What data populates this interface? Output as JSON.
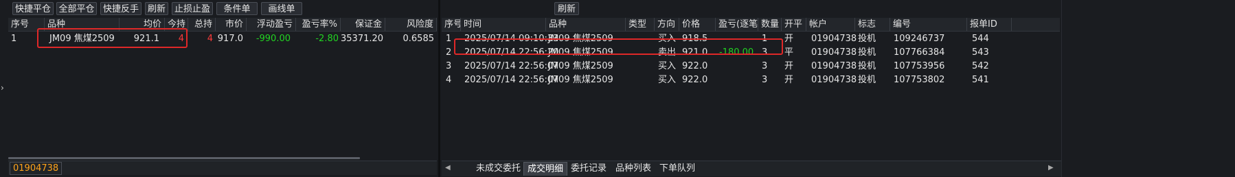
{
  "toolbar": {
    "buttons": [
      "快捷平仓",
      "全部平仓",
      "快捷反手",
      "刷新",
      "止损止盈",
      "条件单",
      "画线单"
    ],
    "right_refresh": "刷新"
  },
  "positions": {
    "headers": [
      "序号",
      "品种",
      "均价",
      "今持",
      "总持",
      "市价",
      "浮动盈亏",
      "盈亏率%",
      "保证金",
      "风险度"
    ],
    "rows": [
      {
        "idx": "1",
        "symbol": "JM09 焦煤2509",
        "avg_price": "921.1",
        "today_hold": "4",
        "total_hold": "4",
        "market_price": "917.0",
        "float_pnl": "-990.00",
        "pnl_rate": "-2.80",
        "margin": "35371.20",
        "risk": "0.6585"
      }
    ],
    "account_tag": "01904738"
  },
  "trades": {
    "headers": [
      "序号",
      "时间",
      "品种",
      "类型",
      "方向",
      "价格",
      "盈亏(逐笔)",
      "数量",
      "开平",
      "帐户",
      "标志",
      "编号",
      "报单ID"
    ],
    "rows": [
      {
        "idx": "1",
        "time": "2025/07/14 09:10:33",
        "symbol": "JM09 焦煤2509",
        "type": "",
        "dir": "买入",
        "price": "918.5",
        "pnl": "",
        "qty": "1",
        "oc": "开",
        "account": "01904738",
        "flag": "投机",
        "no": "109246737",
        "order_id": "544"
      },
      {
        "idx": "2",
        "time": "2025/07/14 22:56:20",
        "symbol": "JM09 焦煤2509",
        "type": "",
        "dir": "卖出",
        "price": "921.0",
        "pnl": "-180.00",
        "qty": "3",
        "oc": "平",
        "account": "01904738",
        "flag": "投机",
        "no": "107766384",
        "order_id": "543"
      },
      {
        "idx": "3",
        "time": "2025/07/14 22:56:07",
        "symbol": "JM09 焦煤2509",
        "type": "",
        "dir": "买入",
        "price": "922.0",
        "pnl": "",
        "qty": "3",
        "oc": "开",
        "account": "01904738",
        "flag": "投机",
        "no": "107753956",
        "order_id": "542"
      },
      {
        "idx": "4",
        "time": "2025/07/14 22:56:07",
        "symbol": "JM09 焦煤2509",
        "type": "",
        "dir": "买入",
        "price": "922.0",
        "pnl": "",
        "qty": "3",
        "oc": "开",
        "account": "01904738",
        "flag": "投机",
        "no": "107753802",
        "order_id": "541"
      }
    ]
  },
  "bottom_tabs": [
    "未成交委托",
    "成交明细",
    "委托记录",
    "品种列表",
    "下单队列"
  ],
  "active_tab": "成交明细",
  "colors": {
    "loss": "#22d422",
    "hold": "#ff3b3b",
    "account": "#ffa31a",
    "highlight": "#e02828"
  }
}
